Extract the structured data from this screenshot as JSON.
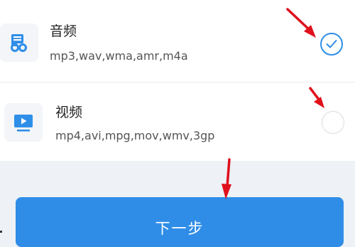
{
  "options": [
    {
      "label": "音频",
      "formats": "mp3,wav,wma,amr,m4a",
      "icon": "audio-icon",
      "selected": true
    },
    {
      "label": "视频",
      "formats": "mp4,avi,mpg,mov,wmv,3gp",
      "icon": "video-icon",
      "selected": false
    }
  ],
  "next_button": {
    "label": "下一步"
  },
  "colors": {
    "accent": "#2f8de8",
    "annotation_arrow": "#e0101c",
    "background": "#eef1f6"
  }
}
